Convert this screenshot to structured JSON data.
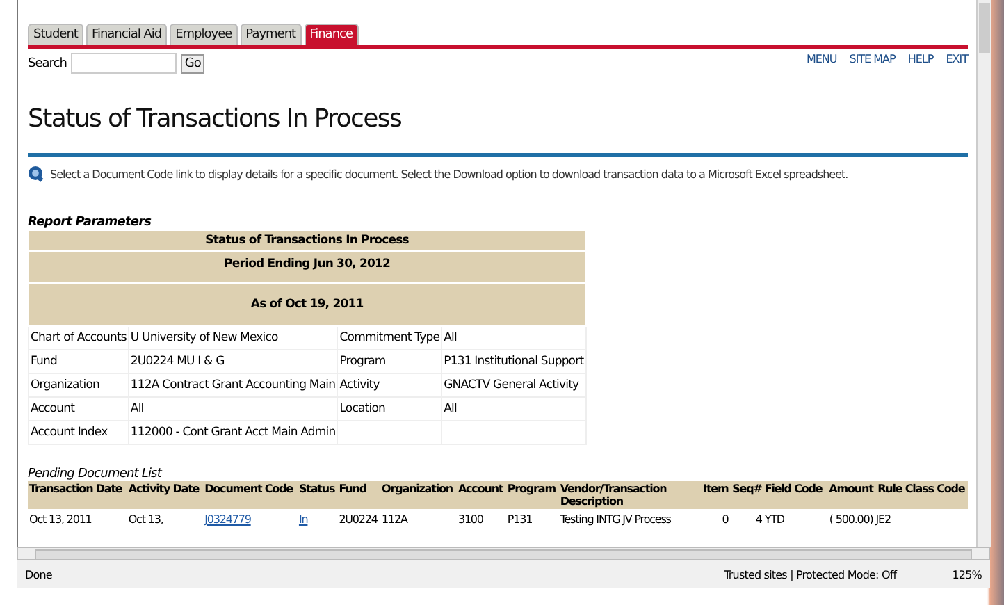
{
  "tabs": [
    {
      "label": "Student",
      "selected": false
    },
    {
      "label": "Financial Aid",
      "selected": false
    },
    {
      "label": "Employee",
      "selected": false
    },
    {
      "label": "Payment",
      "selected": false
    },
    {
      "label": "Finance",
      "selected": true
    }
  ],
  "search": {
    "label": "Search",
    "button": "Go"
  },
  "top_links": [
    "MENU",
    "SITE MAP",
    "HELP",
    "EXIT"
  ],
  "page_title": "Status of Transactions In Process",
  "info_text": "Select a Document Code link to display details for a specific document. Select the Download option to download transaction data to a Microsoft Excel spreadsheet.",
  "report_parameters": {
    "heading": "Report Parameters",
    "title_lines": [
      "Status of Transactions In Process",
      "Period Ending Jun 30, 2012",
      "As of Oct 19, 2011"
    ],
    "rows": [
      [
        "Chart of Accounts",
        "U University of New Mexico",
        "Commitment Type",
        "All"
      ],
      [
        "Fund",
        "2U0224 MU I & G",
        "Program",
        "P131 Institutional Support"
      ],
      [
        "Organization",
        "112A Contract Grant Accounting Main",
        "Activity",
        "GNACTV General Activity"
      ],
      [
        "Account",
        "All",
        "Location",
        "All"
      ],
      [
        "Account Index",
        "112000 - Cont Grant Acct Main Admin",
        "",
        ""
      ]
    ]
  },
  "pending_documents": {
    "heading": "Pending Document List",
    "columns": [
      "Transaction Date",
      "Activity Date",
      "Document Code",
      "Status",
      "Fund",
      "Organization",
      "Account",
      "Program",
      "Vendor/Transaction Description",
      "Item",
      "Seq#",
      "Field Code",
      "Amount",
      "Rule Class Code"
    ],
    "rows": [
      [
        {
          "text": "Oct 13, 2011",
          "kind": "text"
        },
        {
          "text": "Oct 13,",
          "kind": "text"
        },
        {
          "text": "J0324779",
          "kind": "link"
        },
        {
          "text": "In",
          "kind": "link"
        },
        {
          "text": "2U0224",
          "kind": "text"
        },
        {
          "text": "112A",
          "kind": "text"
        },
        {
          "text": "3100",
          "kind": "text"
        },
        {
          "text": "P131",
          "kind": "text"
        },
        {
          "text": "Testing INTG JV Process",
          "kind": "text"
        },
        {
          "text": "0",
          "kind": "text"
        },
        {
          "text": "4",
          "kind": "text"
        },
        {
          "text": "YTD",
          "kind": "text"
        },
        {
          "text": "( 500.00)",
          "kind": "text"
        },
        {
          "text": "JE2",
          "kind": "text"
        }
      ]
    ]
  },
  "status_bar": {
    "status": "Done",
    "zone": "Trusted sites | Protected Mode: Off",
    "zoom": "125%"
  }
}
